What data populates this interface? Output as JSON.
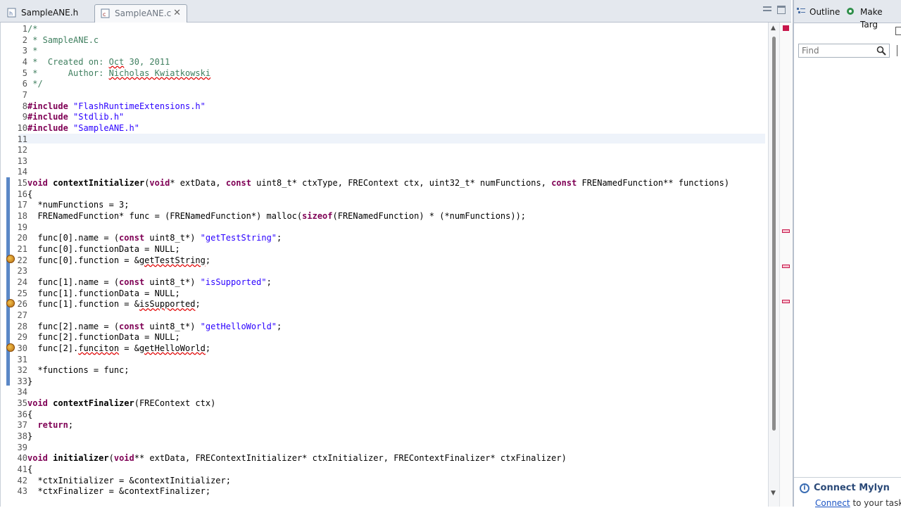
{
  "editor": {
    "tabs": [
      {
        "label": "SampleANE.h",
        "active": false
      },
      {
        "label": "SampleANE.c",
        "active": true,
        "close": "✕"
      }
    ],
    "lines": [
      {
        "n": "1",
        "parts": [
          [
            "cmt",
            "/*"
          ]
        ]
      },
      {
        "n": "2",
        "parts": [
          [
            "cmt",
            " * SampleANE.c"
          ]
        ]
      },
      {
        "n": "3",
        "parts": [
          [
            "cmt",
            " *"
          ]
        ]
      },
      {
        "n": "4",
        "parts": [
          [
            "cmt",
            " *  Created on: "
          ],
          [
            "cmt err",
            "Oct"
          ],
          [
            "cmt",
            " 30, 2011"
          ]
        ]
      },
      {
        "n": "5",
        "parts": [
          [
            "cmt",
            " *      Author: "
          ],
          [
            "cmt err",
            "Nicholas Kwiatkowski"
          ]
        ]
      },
      {
        "n": "6",
        "parts": [
          [
            "cmt",
            " */"
          ]
        ]
      },
      {
        "n": "7",
        "parts": []
      },
      {
        "n": "8",
        "parts": [
          [
            "kw",
            "#include"
          ],
          [
            "str",
            " \"FlashRuntimeExtensions.h\""
          ]
        ]
      },
      {
        "n": "9",
        "parts": [
          [
            "kw",
            "#include"
          ],
          [
            "str",
            " \"Stdlib.h\""
          ]
        ]
      },
      {
        "n": "10",
        "parts": [
          [
            "kw",
            "#include"
          ],
          [
            "str",
            " \"SampleANE.h\""
          ]
        ]
      },
      {
        "n": "11",
        "parts": []
      },
      {
        "n": "12",
        "parts": []
      },
      {
        "n": "13",
        "parts": []
      },
      {
        "n": "14",
        "parts": []
      },
      {
        "n": "15",
        "parts": [
          [
            "kw",
            "void"
          ],
          [
            "",
            ""
          ],
          [
            "fn",
            " contextInitializer"
          ],
          [
            "",
            "("
          ],
          [
            "kw",
            "void"
          ],
          [
            "",
            "* extData, "
          ],
          [
            "kw",
            "const"
          ],
          [
            "",
            " uint8_t* ctxType, FREContext ctx, uint32_t* numFunctions, "
          ],
          [
            "kw",
            "const"
          ],
          [
            "",
            " FRENamedFunction** functions)"
          ]
        ]
      },
      {
        "n": "16",
        "parts": [
          [
            "",
            "{"
          ]
        ]
      },
      {
        "n": "17",
        "parts": [
          [
            "",
            "  *numFunctions = 3;"
          ]
        ]
      },
      {
        "n": "18",
        "parts": [
          [
            "",
            "  FRENamedFunction* func = (FRENamedFunction*) malloc("
          ],
          [
            "kw",
            "sizeof"
          ],
          [
            "",
            "(FRENamedFunction) * (*numFunctions));"
          ]
        ]
      },
      {
        "n": "19",
        "parts": []
      },
      {
        "n": "20",
        "parts": [
          [
            "",
            "  func[0].name = ("
          ],
          [
            "kw",
            "const"
          ],
          [
            "",
            " uint8_t*) "
          ],
          [
            "str",
            "\"getTestString\""
          ],
          [
            "",
            ";"
          ]
        ]
      },
      {
        "n": "21",
        "parts": [
          [
            "",
            "  func[0].functionData = NULL;"
          ]
        ]
      },
      {
        "n": "22",
        "parts": [
          [
            "",
            "  func[0].function = &"
          ],
          [
            "err",
            "getTestString"
          ],
          [
            "",
            ";"
          ]
        ]
      },
      {
        "n": "23",
        "parts": []
      },
      {
        "n": "24",
        "parts": [
          [
            "",
            "  func[1].name = ("
          ],
          [
            "kw",
            "const"
          ],
          [
            "",
            " uint8_t*) "
          ],
          [
            "str",
            "\"isSupported\""
          ],
          [
            "",
            ";"
          ]
        ]
      },
      {
        "n": "25",
        "parts": [
          [
            "",
            "  func[1].functionData = NULL;"
          ]
        ]
      },
      {
        "n": "26",
        "parts": [
          [
            "",
            "  func[1].function = &"
          ],
          [
            "err",
            "isSupported"
          ],
          [
            "",
            ";"
          ]
        ]
      },
      {
        "n": "27",
        "parts": []
      },
      {
        "n": "28",
        "parts": [
          [
            "",
            "  func[2].name = ("
          ],
          [
            "kw",
            "const"
          ],
          [
            "",
            " uint8_t*) "
          ],
          [
            "str",
            "\"getHelloWorld\""
          ],
          [
            "",
            ";"
          ]
        ]
      },
      {
        "n": "29",
        "parts": [
          [
            "",
            "  func[2].functionData = NULL;"
          ]
        ]
      },
      {
        "n": "30",
        "parts": [
          [
            "",
            "  func[2]."
          ],
          [
            "err",
            "funciton"
          ],
          [
            "",
            " = &"
          ],
          [
            "err",
            "getHelloWorld"
          ],
          [
            "",
            ";"
          ]
        ]
      },
      {
        "n": "31",
        "parts": []
      },
      {
        "n": "32",
        "parts": [
          [
            "",
            "  *functions = func;"
          ]
        ]
      },
      {
        "n": "33",
        "parts": [
          [
            "",
            "}"
          ]
        ]
      },
      {
        "n": "34",
        "parts": []
      },
      {
        "n": "35",
        "parts": [
          [
            "kw",
            "void"
          ],
          [
            "fn",
            " contextFinalizer"
          ],
          [
            "",
            "(FREContext ctx)"
          ]
        ]
      },
      {
        "n": "36",
        "parts": [
          [
            "",
            "{"
          ]
        ]
      },
      {
        "n": "37",
        "parts": [
          [
            "",
            "  "
          ],
          [
            "kw",
            "return"
          ],
          [
            "",
            ";"
          ]
        ]
      },
      {
        "n": "38",
        "parts": [
          [
            "",
            "}"
          ]
        ]
      },
      {
        "n": "39",
        "parts": []
      },
      {
        "n": "40",
        "parts": [
          [
            "kw",
            "void"
          ],
          [
            "fn",
            " initializer"
          ],
          [
            "",
            "("
          ],
          [
            "kw",
            "void"
          ],
          [
            "",
            "** extData, FREContextInitializer* ctxInitializer, FREContextFinalizer* ctxFinalizer)"
          ]
        ]
      },
      {
        "n": "41",
        "parts": [
          [
            "",
            "{"
          ]
        ]
      },
      {
        "n": "42",
        "parts": [
          [
            "",
            "  *ctxInitializer = &contextInitializer;"
          ]
        ]
      },
      {
        "n": "43",
        "parts": [
          [
            "",
            "  *ctxFinalizer = &contextFinalizer;"
          ]
        ]
      }
    ]
  },
  "right_panel": {
    "tabs": [
      {
        "label": "Outline",
        "icon": "outline-icon"
      },
      {
        "label": "Make Targ",
        "icon": "make-target-icon"
      }
    ],
    "find_placeholder": "Find",
    "mylyn": {
      "title": "Connect Mylyn",
      "link": "Connect",
      "text": " to your task a"
    }
  },
  "colors": {
    "keyword": "#7f0055",
    "string": "#2a00ff",
    "comment": "#3f7f5f",
    "error_underline": "#e00000",
    "scope_bar": "#5b88c6"
  }
}
